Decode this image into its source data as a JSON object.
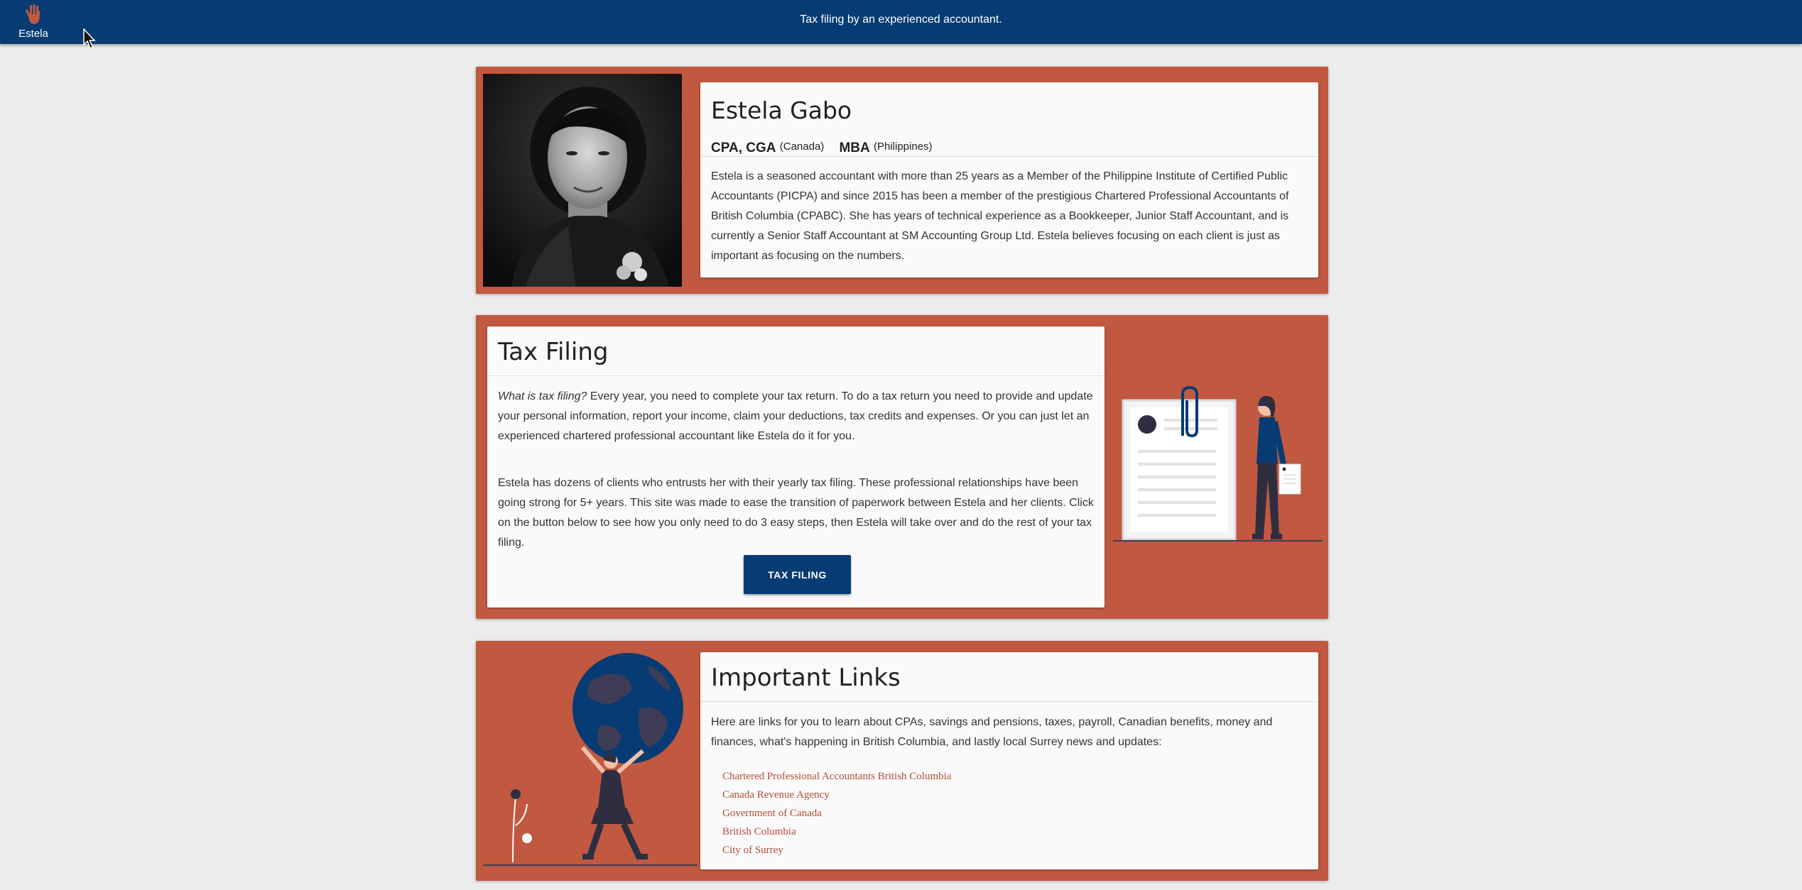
{
  "header": {
    "brand_name": "Estela",
    "tagline": "Tax filing by an experienced accountant."
  },
  "profile": {
    "name": "Estela Gabo",
    "cred1": "CPA, CGA",
    "cred1_note": "(Canada)",
    "cred2": "MBA",
    "cred2_note": "(Philippines)",
    "bio": "Estela is a seasoned accountant with more than 25 years as a Member of the Philippine Institute of Certified Public Accountants (PICPA) and since 2015 has been a member of the prestigious Chartered Professional Accountants of British Columbia (CPABC). She has years of technical experience as a Bookkeeper, Junior Staff Accountant, and is currently a Senior Staff Accountant at SM Accounting Group Ltd. Estela believes focusing on each client is just as important as focusing on the numbers."
  },
  "tax": {
    "title": "Tax Filing",
    "p1_question": "What is tax filing?",
    "p1_text": " Every year, you need to complete your tax return. To do a tax return you need to provide and update your personal information, report your income, claim your deductions, tax credits and expenses. Or you can just let an experienced chartered professional accountant like Estela do it for you.",
    "p2_text": "Estela has dozens of clients who entrusts her with their yearly tax filing. These professional relationships have been going strong for 5+ years. This site was made to ease the transition of paperwork between Estela and her clients. Click on the button below to see how you only need to do 3 easy steps, then Estela will take over and do the rest of your tax filing.",
    "button_label": "TAX FILING"
  },
  "links": {
    "title": "Important Links",
    "intro": "Here are links for you to learn about CPAs, savings and pensions, taxes, payroll, Canadian benefits, money and finances, what's happening in British Columbia, and lastly local Surrey news and updates:",
    "items": [
      "Chartered Professional Accountants British Columbia",
      "Canada Revenue Agency",
      "Government of Canada",
      "British Columbia",
      "City of Surrey"
    ]
  },
  "colors": {
    "primary": "#073b73",
    "accent": "#c15840",
    "background": "#ececec",
    "link": "#b24c35"
  },
  "icons": {
    "brand": "hand-icon",
    "cursor": "mouse-pointer-icon"
  }
}
